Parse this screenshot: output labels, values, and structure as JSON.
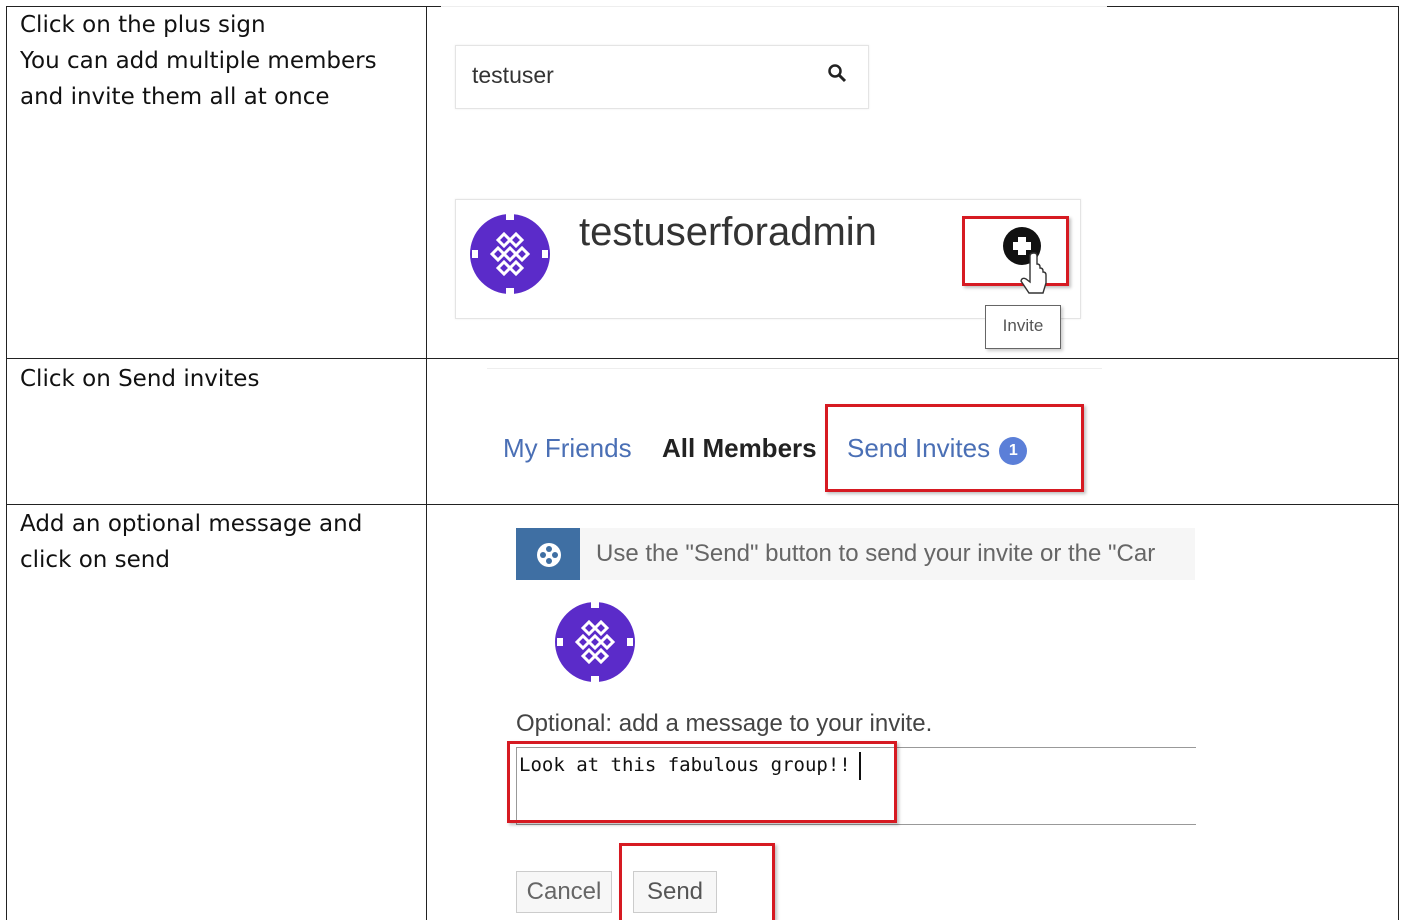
{
  "rows": [
    {
      "instruction_lines": [
        "Click on the plus sign",
        "You can add multiple members",
        "and invite them all at once"
      ]
    },
    {
      "instruction_lines": [
        "Click on Send invites"
      ]
    },
    {
      "instruction_lines": [
        "Add an optional message and",
        "click on send"
      ]
    }
  ],
  "step1": {
    "search_value": "testuser",
    "search_icon": "search-icon",
    "member_name": "testuserforadmin",
    "avatar_icon": "purple-pattern-avatar",
    "add_icon": "plus-circle-icon",
    "tooltip": "Invite"
  },
  "step2": {
    "tabs": [
      "My Friends",
      "All Members",
      "Send Invites"
    ],
    "invite_count": "1"
  },
  "step3": {
    "notice_text": "Use the \"Send\" button to send your invite or the \"Car",
    "notice_icon": "info-icon",
    "message_label": "Optional: add a message to your invite.",
    "message_value": "Look at this fabulous group!!",
    "cancel_label": "Cancel",
    "send_label": "Send"
  },
  "colors": {
    "accent_blue": "#4a6fb5",
    "highlight_red": "#d61a22",
    "avatar_purple": "#5b2bc9",
    "badge_blue": "#5b7fd8"
  }
}
